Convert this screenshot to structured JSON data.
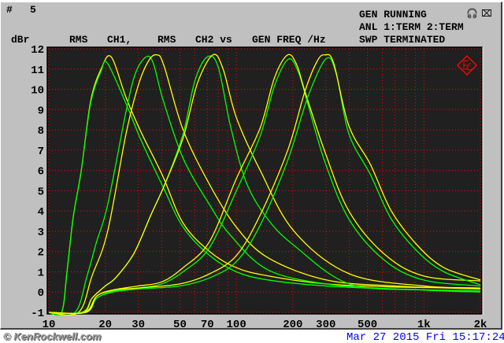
{
  "header": {
    "hash_label": "#",
    "test_number": "5",
    "status_lines": [
      "GEN RUNNING",
      "ANL 1:TERM 2:TERM",
      "SWP TERMINATED"
    ],
    "title_parts": [
      "RMS",
      "CH1,",
      "RMS",
      "CH2 vs",
      "GEN FREQ /Hz"
    ],
    "icons": [
      "headphones-icon",
      "speaker-muted-icon"
    ]
  },
  "footer": {
    "watermark": "© KenRockwell.com",
    "datetime": "Mar 27 2015 Fri 15:17:24"
  },
  "colors": {
    "background": "#c0c0c0",
    "plot_bg": "#202020",
    "grid": "#ff0000",
    "ch1": "#ffff00",
    "ch2": "#00ff00",
    "date": "#0000ff"
  },
  "chart_data": {
    "type": "line",
    "title": "RMS CH1, RMS CH2 vs GEN FREQ /Hz",
    "ylabel": "dBr",
    "xlabel": "Hz",
    "xscale": "log",
    "xlim": [
      10,
      2000
    ],
    "ylim": [
      -1,
      12
    ],
    "grid": true,
    "yticks": [
      -1,
      0,
      1,
      2,
      3,
      4,
      5,
      6,
      7,
      8,
      9,
      10,
      11,
      12
    ],
    "xticks": [
      {
        "value": 10,
        "label": "10"
      },
      {
        "value": 20,
        "label": "20"
      },
      {
        "value": 30,
        "label": "30"
      },
      {
        "value": 50,
        "label": "50"
      },
      {
        "value": 70,
        "label": "70"
      },
      {
        "value": 100,
        "label": "100"
      },
      {
        "value": 200,
        "label": "200"
      },
      {
        "value": 300,
        "label": "300"
      },
      {
        "value": 500,
        "label": "500"
      },
      {
        "value": 1000,
        "label": "1k"
      },
      {
        "value": 2000,
        "label": "2k"
      }
    ],
    "series": [
      {
        "name": "CH1 sweep 1",
        "color": "#ffff00",
        "points": [
          [
            10,
            -1
          ],
          [
            11.7,
            -1
          ],
          [
            12.5,
            1
          ],
          [
            13.5,
            3.7
          ],
          [
            14.9,
            6
          ],
          [
            16.7,
            9.4
          ],
          [
            19,
            11
          ],
          [
            21.5,
            11.6
          ],
          [
            25.8,
            9.6
          ],
          [
            31,
            7.9
          ],
          [
            40.6,
            5.7
          ],
          [
            52,
            3.4
          ],
          [
            72,
            2
          ],
          [
            100,
            1.2
          ],
          [
            147,
            0.8
          ],
          [
            300,
            0.4
          ],
          [
            700,
            0.25
          ],
          [
            2000,
            0.2
          ]
        ]
      },
      {
        "name": "CH2 sweep 1",
        "color": "#00ff00",
        "points": [
          [
            10,
            -1
          ],
          [
            11.7,
            -1
          ],
          [
            12.5,
            1
          ],
          [
            13.5,
            3.7
          ],
          [
            14.9,
            6
          ],
          [
            16.7,
            9.3
          ],
          [
            19,
            10.9
          ],
          [
            20.5,
            11.3
          ],
          [
            25.8,
            9.3
          ],
          [
            31,
            7.5
          ],
          [
            40.6,
            5.2
          ],
          [
            52,
            3.2
          ],
          [
            72,
            1.8
          ],
          [
            100,
            1.0
          ],
          [
            147,
            0.6
          ],
          [
            300,
            0.3
          ],
          [
            700,
            0.15
          ],
          [
            2000,
            0.05
          ]
        ]
      },
      {
        "name": "CH2 sweep 2",
        "color": "#00ff00",
        "points": [
          [
            10,
            -1
          ],
          [
            13.8,
            -1
          ],
          [
            16,
            0.8
          ],
          [
            18,
            2.5
          ],
          [
            20.6,
            4.3
          ],
          [
            25.8,
            8.9
          ],
          [
            29,
            10.8
          ],
          [
            33,
            11.6
          ],
          [
            36,
            11.3
          ],
          [
            40.6,
            9.5
          ],
          [
            52,
            6.6
          ],
          [
            72,
            4.3
          ],
          [
            93,
            2.8
          ],
          [
            147,
            1.1
          ],
          [
            300,
            0.4
          ],
          [
            700,
            0.15
          ],
          [
            2000,
            0.05
          ]
        ]
      },
      {
        "name": "CH1 sweep 2",
        "color": "#ffff00",
        "points": [
          [
            10,
            -1
          ],
          [
            14.4,
            -1
          ],
          [
            17,
            0.8
          ],
          [
            20.6,
            3.0
          ],
          [
            25.8,
            7.8
          ],
          [
            30,
            10.2
          ],
          [
            34,
            11.4
          ],
          [
            37.5,
            11.7
          ],
          [
            41,
            11.2
          ],
          [
            52,
            8.0
          ],
          [
            72,
            5.3
          ],
          [
            100,
            3.2
          ],
          [
            147,
            1.7
          ],
          [
            300,
            0.6
          ],
          [
            700,
            0.3
          ],
          [
            2000,
            0.15
          ]
        ]
      },
      {
        "name": "CH2 sweep 3",
        "color": "#00ff00",
        "points": [
          [
            10,
            -1
          ],
          [
            15,
            -1
          ],
          [
            17,
            -0.3
          ],
          [
            20,
            0.3
          ],
          [
            22.7,
            0.7
          ],
          [
            28.4,
            1.9
          ],
          [
            35,
            3.8
          ],
          [
            41.9,
            5.4
          ],
          [
            52,
            7.8
          ],
          [
            60,
            10.4
          ],
          [
            70,
            11.6
          ],
          [
            80,
            11.1
          ],
          [
            93,
            8.2
          ],
          [
            113,
            5.4
          ],
          [
            147,
            3.6
          ],
          [
            203,
            2.3
          ],
          [
            400,
            0.4
          ],
          [
            1000,
            0.1
          ],
          [
            2000,
            0.0
          ]
        ]
      },
      {
        "name": "CH1 sweep 3",
        "color": "#ffff00",
        "points": [
          [
            10,
            -1
          ],
          [
            15.2,
            -1
          ],
          [
            17,
            -0.3
          ],
          [
            20,
            0.3
          ],
          [
            22.7,
            0.7
          ],
          [
            28.4,
            1.9
          ],
          [
            35,
            3.8
          ],
          [
            41.9,
            5.4
          ],
          [
            52,
            7.6
          ],
          [
            62,
            10.3
          ],
          [
            75,
            11.7
          ],
          [
            85,
            11.0
          ],
          [
            100,
            8.6
          ],
          [
            134,
            6.0
          ],
          [
            203,
            3.0
          ],
          [
            400,
            0.9
          ],
          [
            1000,
            0.3
          ],
          [
            2000,
            0.2
          ]
        ]
      },
      {
        "name": "CH2 sweep 4",
        "color": "#00ff00",
        "points": [
          [
            10,
            -1
          ],
          [
            15.5,
            -1
          ],
          [
            18,
            -0.3
          ],
          [
            22,
            0.05
          ],
          [
            30,
            0.2
          ],
          [
            40,
            0.4
          ],
          [
            52,
            1.0
          ],
          [
            72,
            2.2
          ],
          [
            100,
            5.0
          ],
          [
            134,
            7.7
          ],
          [
            160,
            10.2
          ],
          [
            190,
            11.5
          ],
          [
            215,
            10.8
          ],
          [
            240,
            9.3
          ],
          [
            297,
            6.4
          ],
          [
            398,
            3.6
          ],
          [
            610,
            1.6
          ],
          [
            990,
            0.6
          ],
          [
            2000,
            0.3
          ]
        ]
      },
      {
        "name": "CH1 sweep 4",
        "color": "#ffff00",
        "points": [
          [
            10,
            -1
          ],
          [
            15.5,
            -1
          ],
          [
            18,
            -0.2
          ],
          [
            22,
            0.1
          ],
          [
            30,
            0.3
          ],
          [
            40,
            0.5
          ],
          [
            52,
            1.2
          ],
          [
            72,
            2.5
          ],
          [
            100,
            5.6
          ],
          [
            134,
            8.1
          ],
          [
            160,
            10.6
          ],
          [
            188,
            11.7
          ],
          [
            210,
            11.2
          ],
          [
            232,
            9.9
          ],
          [
            297,
            6.9
          ],
          [
            398,
            4.0
          ],
          [
            610,
            1.9
          ],
          [
            990,
            0.8
          ],
          [
            2000,
            0.55
          ]
        ]
      },
      {
        "name": "CH2 sweep 5",
        "color": "#00ff00",
        "points": [
          [
            10,
            -1
          ],
          [
            15.8,
            -1
          ],
          [
            18,
            -0.3
          ],
          [
            22,
            0
          ],
          [
            30,
            0.15
          ],
          [
            50,
            0.3
          ],
          [
            72,
            0.7
          ],
          [
            100,
            1.5
          ],
          [
            134,
            3.3
          ],
          [
            188,
            6.5
          ],
          [
            240,
            9.6
          ],
          [
            300,
            11.5
          ],
          [
            340,
            10.8
          ],
          [
            398,
            7.8
          ],
          [
            518,
            5.8
          ],
          [
            670,
            3.6
          ],
          [
            924,
            2.0
          ],
          [
            1280,
            1.0
          ],
          [
            2000,
            0.36
          ]
        ]
      },
      {
        "name": "CH1 sweep 5",
        "color": "#ffff00",
        "points": [
          [
            10,
            -1
          ],
          [
            15.8,
            -1
          ],
          [
            18,
            -0.2
          ],
          [
            22,
            0.1
          ],
          [
            30,
            0.2
          ],
          [
            50,
            0.4
          ],
          [
            72,
            0.9
          ],
          [
            100,
            1.8
          ],
          [
            134,
            3.8
          ],
          [
            188,
            7.0
          ],
          [
            232,
            9.9
          ],
          [
            270,
            11.4
          ],
          [
            297,
            11.7
          ],
          [
            330,
            11.3
          ],
          [
            398,
            8.2
          ],
          [
            518,
            6.3
          ],
          [
            670,
            4.0
          ],
          [
            924,
            2.3
          ],
          [
            1280,
            1.2
          ],
          [
            2000,
            0.6
          ]
        ]
      }
    ]
  }
}
